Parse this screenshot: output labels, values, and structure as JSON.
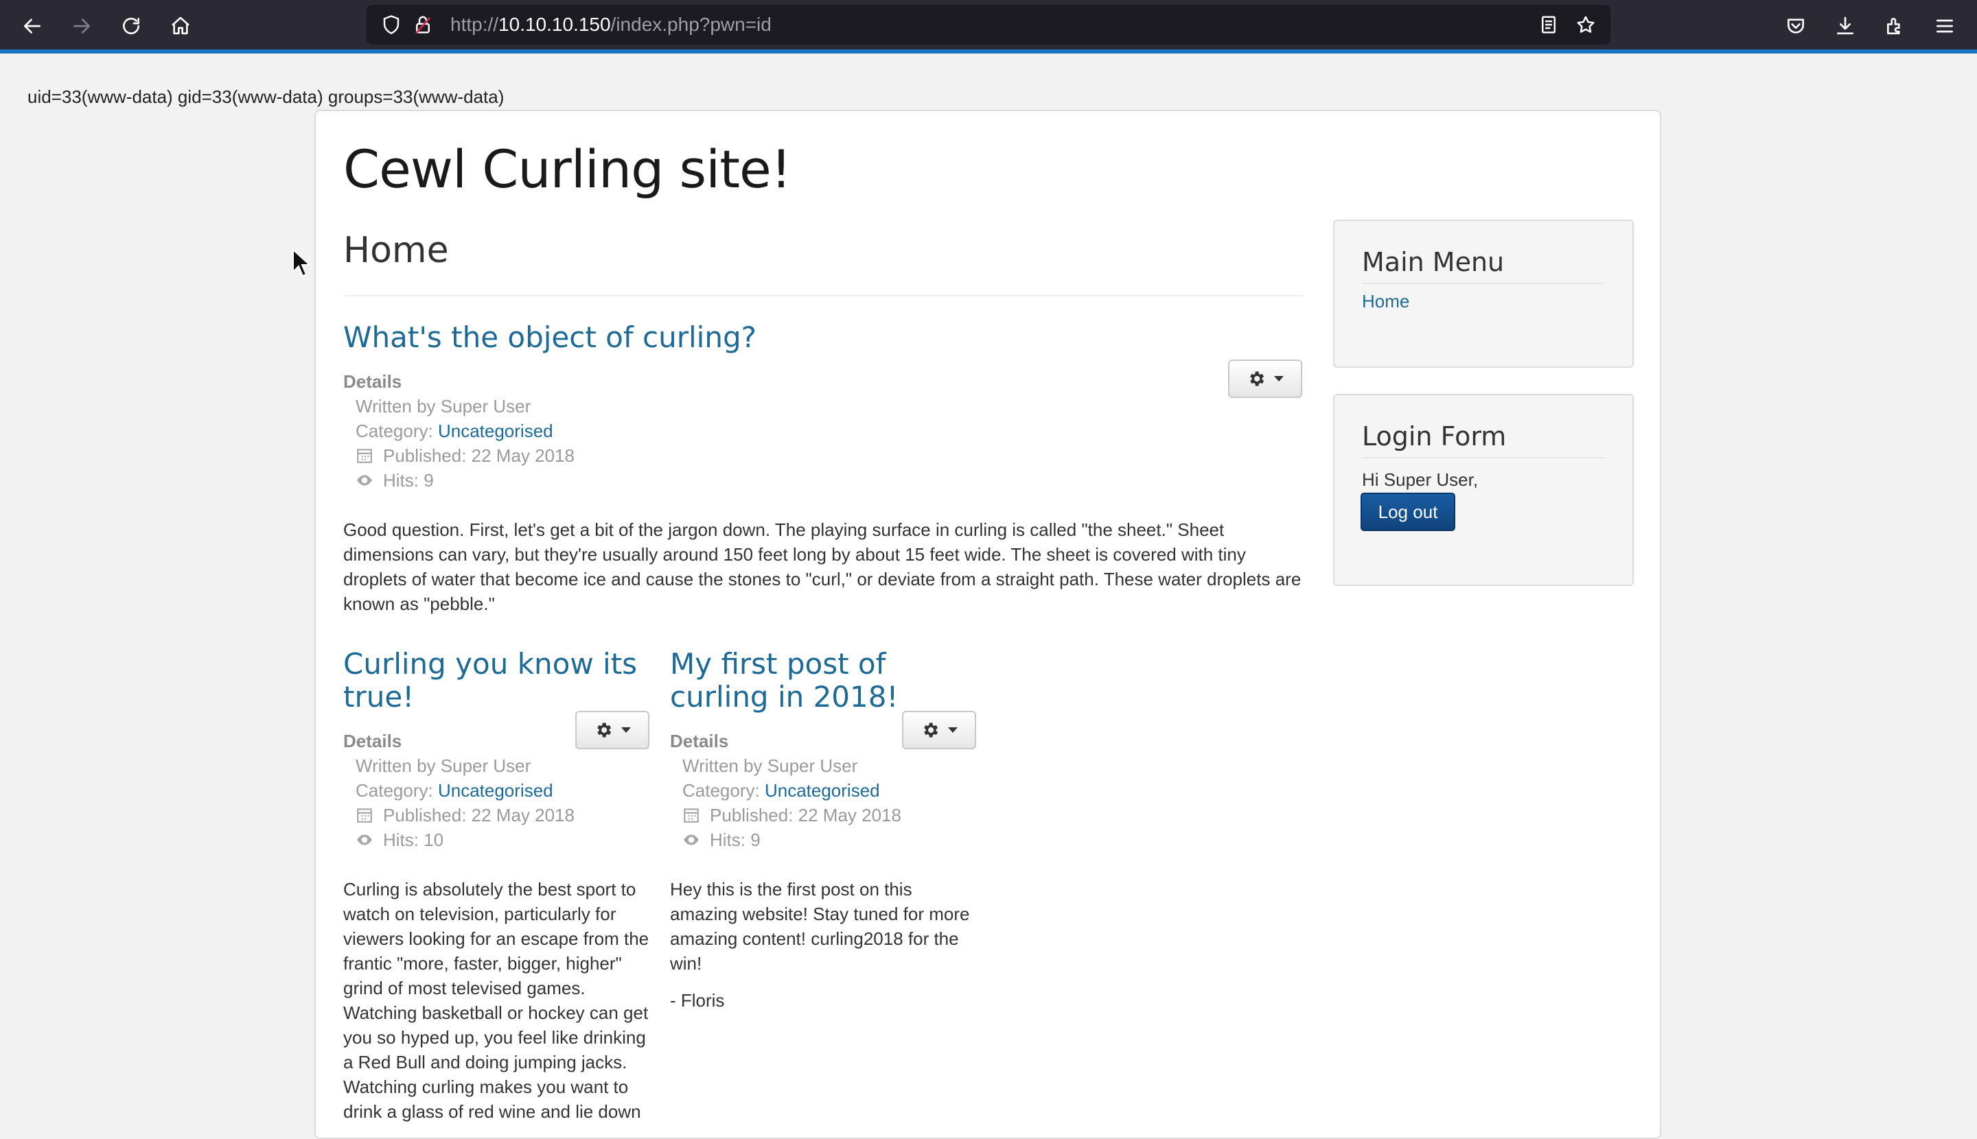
{
  "browser": {
    "url_prefix": "http://",
    "url_host": "10.10.10.150",
    "url_path": "/index.php?pwn=id",
    "icons": [
      "back-arrow-icon",
      "forward-arrow-icon",
      "reload-icon",
      "home-icon",
      "shield-icon",
      "lock-icon",
      "reader-view-icon",
      "star-icon",
      "pocket-icon",
      "download-icon",
      "extensions-icon",
      "menu-icon"
    ]
  },
  "command_output": "uid=33(www-data) gid=33(www-data) groups=33(www-data)",
  "site": {
    "title": "Cewl Curling site!",
    "page_heading": "Home"
  },
  "articles": [
    {
      "title": "What's the object of curling?",
      "details_label": "Details",
      "written_by": "Written by Super User",
      "category_prefix": "Category: ",
      "category": "Uncategorised",
      "published": "Published: 22 May 2018",
      "hits": "Hits: 9",
      "paragraphs": [
        "Good question. First, let's get a bit of the jargon down. The playing surface in curling is called \"the sheet.\" Sheet dimensions can vary, but they're usually around 150 feet long by about 15 feet wide. The sheet is covered with tiny droplets of water that become ice and cause the stones to \"curl,\" or deviate from a straight path. These water droplets are known as \"pebble.\""
      ]
    },
    {
      "title": "Curling you know its true!",
      "details_label": "Details",
      "written_by": "Written by Super User",
      "category_prefix": "Category: ",
      "category": "Uncategorised",
      "published": "Published: 22 May 2018",
      "hits": "Hits: 10",
      "paragraphs": [
        "Curling is absolutely the best sport to watch on television, particularly for viewers looking for an escape from the frantic \"more, faster, bigger, higher\" grind of most televised games. Watching basketball or hockey can get you so hyped up, you feel like drinking a Red Bull and doing jumping jacks. Watching curling makes you want to drink a glass of red wine and lie down"
      ]
    },
    {
      "title": "My first post of curling in 2018!",
      "details_label": "Details",
      "written_by": "Written by Super User",
      "category_prefix": "Category: ",
      "category": "Uncategorised",
      "published": "Published: 22 May 2018",
      "hits": "Hits: 9",
      "paragraphs": [
        "Hey this is the first post on this amazing website! Stay tuned for more amazing content! curling2018 for the win!",
        "- Floris"
      ]
    }
  ],
  "sidebar": {
    "main_menu": {
      "title": "Main Menu",
      "items": [
        "Home"
      ]
    },
    "login_form": {
      "title": "Login Form",
      "greeting": "Hi Super User,",
      "logout_label": "Log out"
    }
  },
  "colors": {
    "link": "#1d6a96",
    "logout_button": "#124c8c",
    "chrome": "#2b2a33",
    "accent_line": "#1a76c2"
  }
}
